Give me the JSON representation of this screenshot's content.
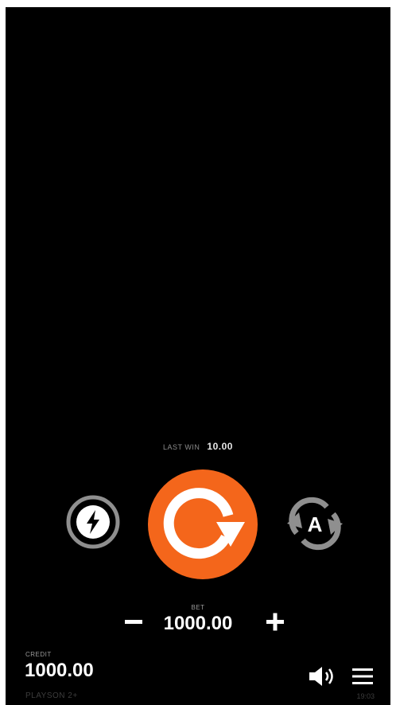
{
  "colors": {
    "background": "#000000",
    "accent": "#f4661b",
    "icon_grey": "#8f8f8f",
    "text": "#ffffff"
  },
  "last_win": {
    "label": "LAST WIN",
    "value": "10.00"
  },
  "controls": {
    "turbo_icon": "lightning-bolt-icon",
    "spin_icon": "circular-arrow-icon",
    "autoplay_icon": "autoplay-icon",
    "autoplay_letter": "A"
  },
  "bet": {
    "label": "BET",
    "value": "1000.00",
    "decrease_icon": "minus-icon",
    "increase_icon": "plus-icon"
  },
  "credit": {
    "label": "CREDIT",
    "value": "1000.00"
  },
  "footer": {
    "brand": "PLAYSON 2+",
    "clock": "19:03",
    "sound_icon": "speaker-icon",
    "menu_icon": "hamburger-menu-icon"
  }
}
